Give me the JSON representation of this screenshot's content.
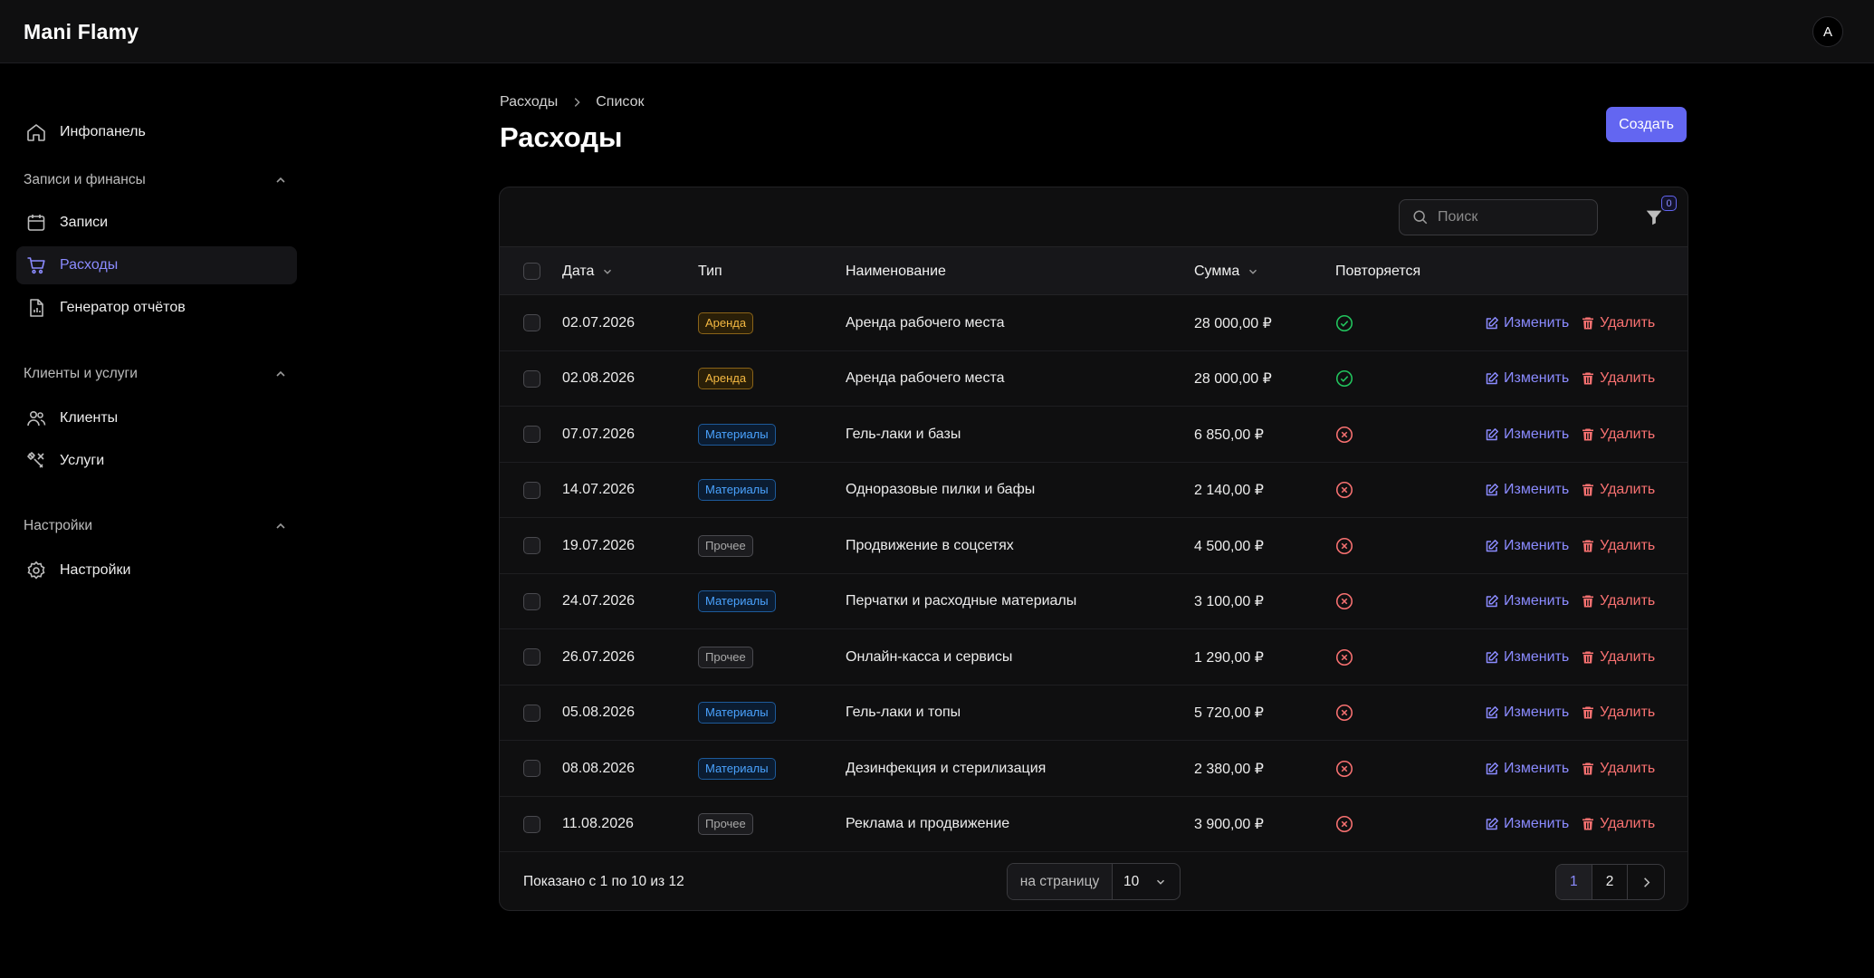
{
  "app": {
    "brand": "Mani Flamy",
    "avatar": "A"
  },
  "sidebar": {
    "dashboard": "Инфопанель",
    "groups": [
      {
        "title": "Записи и финансы",
        "items": [
          "Записи",
          "Расходы",
          "Генератор отчётов"
        ]
      },
      {
        "title": "Клиенты и услуги",
        "items": [
          "Клиенты",
          "Услуги"
        ]
      },
      {
        "title": "Настройки",
        "items": [
          "Настройки"
        ]
      }
    ],
    "active": "Расходы"
  },
  "breadcrumb": [
    "Расходы",
    "Список"
  ],
  "page": {
    "title": "Расходы",
    "create_label": "Создать"
  },
  "toolbar": {
    "search_placeholder": "Поиск",
    "filter_count": "0"
  },
  "table": {
    "columns": {
      "date": "Дата",
      "type": "Тип",
      "name": "Наименование",
      "amount": "Сумма",
      "recurring": "Повторяется"
    },
    "actions": {
      "edit": "Изменить",
      "delete": "Удалить"
    },
    "rows": [
      {
        "date": "02.07.2026",
        "type": "Аренда",
        "type_kind": "rent",
        "name": "Аренда рабочего места",
        "amount": "28 000,00 ₽",
        "recurring": true
      },
      {
        "date": "02.08.2026",
        "type": "Аренда",
        "type_kind": "rent",
        "name": "Аренда рабочего места",
        "amount": "28 000,00 ₽",
        "recurring": true
      },
      {
        "date": "07.07.2026",
        "type": "Материалы",
        "type_kind": "mat",
        "name": "Гель-лаки и базы",
        "amount": "6 850,00 ₽",
        "recurring": false
      },
      {
        "date": "14.07.2026",
        "type": "Материалы",
        "type_kind": "mat",
        "name": "Одноразовые пилки и бафы",
        "amount": "2 140,00 ₽",
        "recurring": false
      },
      {
        "date": "19.07.2026",
        "type": "Прочее",
        "type_kind": "other",
        "name": "Продвижение в соцсетях",
        "amount": "4 500,00 ₽",
        "recurring": false
      },
      {
        "date": "24.07.2026",
        "type": "Материалы",
        "type_kind": "mat",
        "name": "Перчатки и расходные материалы",
        "amount": "3 100,00 ₽",
        "recurring": false
      },
      {
        "date": "26.07.2026",
        "type": "Прочее",
        "type_kind": "other",
        "name": "Онлайн-касса и сервисы",
        "amount": "1 290,00 ₽",
        "recurring": false
      },
      {
        "date": "05.08.2026",
        "type": "Материалы",
        "type_kind": "mat",
        "name": "Гель-лаки и топы",
        "amount": "5 720,00 ₽",
        "recurring": false
      },
      {
        "date": "08.08.2026",
        "type": "Материалы",
        "type_kind": "mat",
        "name": "Дезинфекция и стерилизация",
        "amount": "2 380,00 ₽",
        "recurring": false
      },
      {
        "date": "11.08.2026",
        "type": "Прочее",
        "type_kind": "other",
        "name": "Реклама и продвижение",
        "amount": "3 900,00 ₽",
        "recurring": false
      }
    ]
  },
  "footer": {
    "showing": "Показано с 1 по 10 из 12",
    "per_page_label": "на страницу",
    "per_page_value": "10",
    "pages": [
      "1",
      "2"
    ],
    "current_page": "1"
  },
  "colors": {
    "accent": "#6366f1",
    "success": "#22c55e",
    "danger": "#f87171",
    "rent": "#f5b942",
    "materials": "#4aa3ff"
  }
}
